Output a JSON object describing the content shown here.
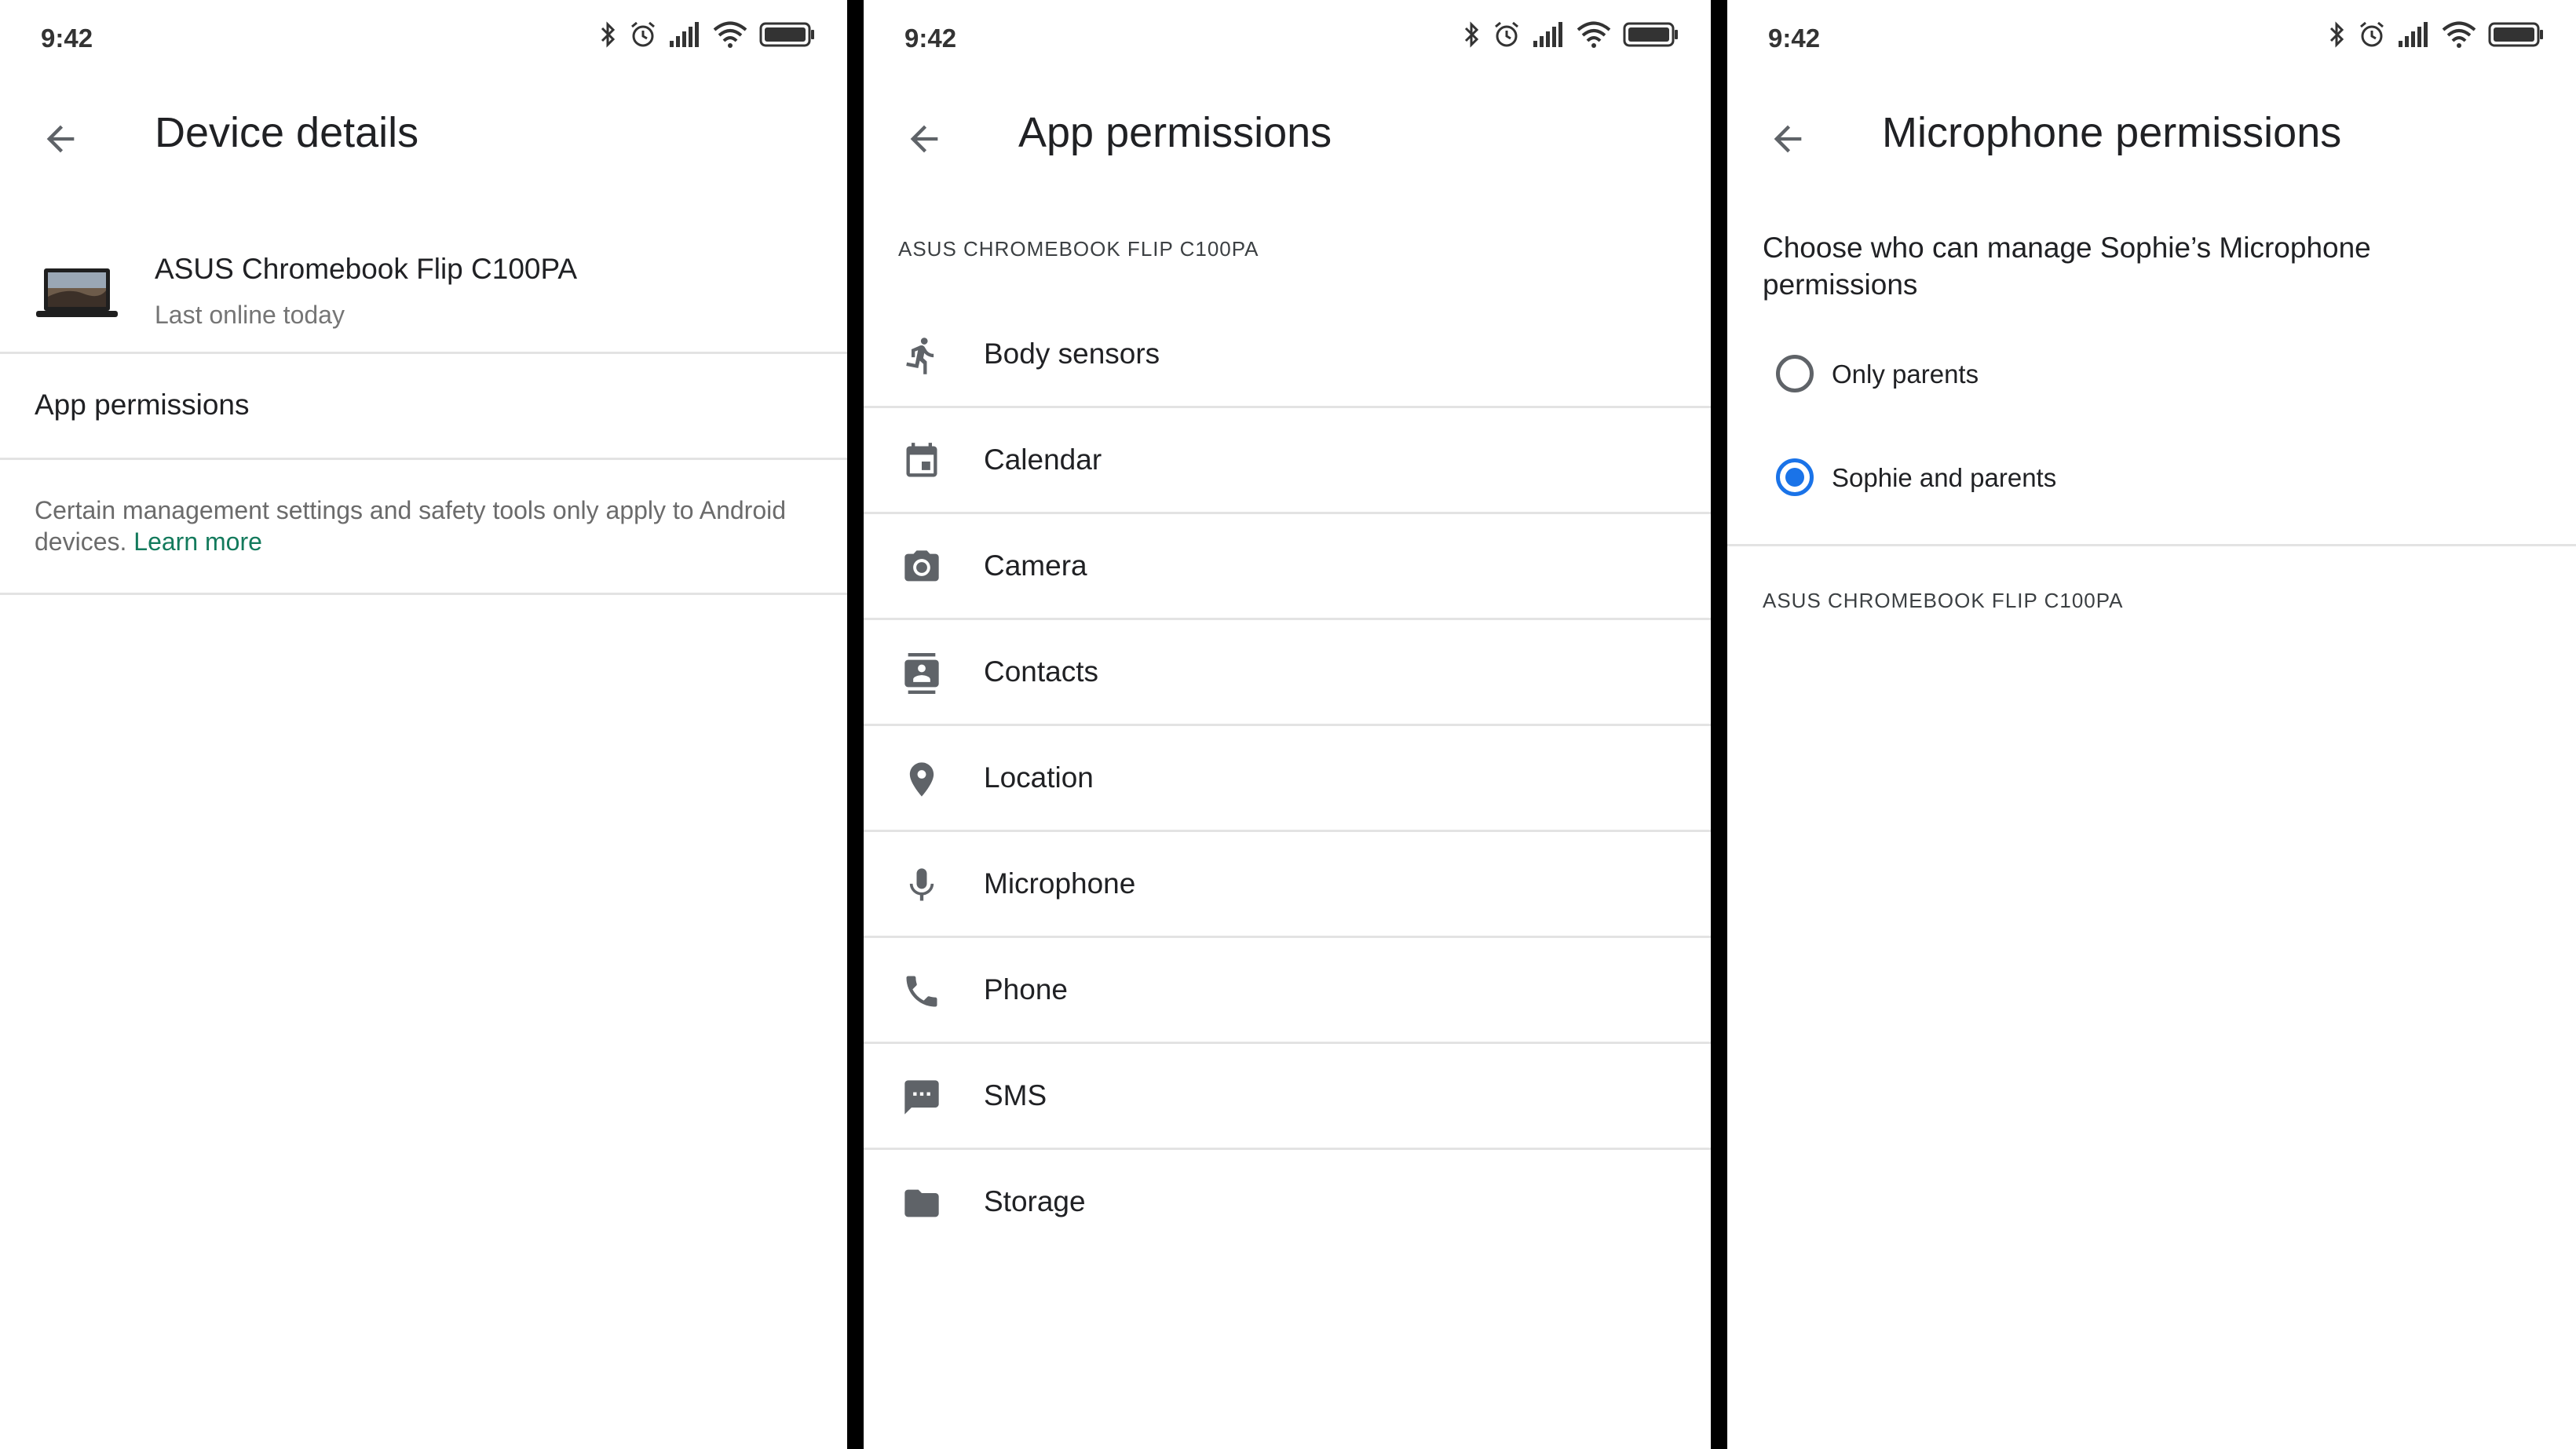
{
  "status_bar": {
    "time": "9:42"
  },
  "screen1": {
    "title": "Device details",
    "device": {
      "name": "ASUS Chromebook Flip C100PA",
      "status": "Last online today"
    },
    "app_permissions_label": "App permissions",
    "note_text": "Certain management settings and safety tools only apply to Android devices.",
    "learn_more_label": "Learn more"
  },
  "screen2": {
    "title": "App permissions",
    "device_label": "ASUS CHROMEBOOK FLIP C100PA",
    "items": [
      {
        "label": "Body sensors",
        "icon": "body-sensors-icon"
      },
      {
        "label": "Calendar",
        "icon": "calendar-icon"
      },
      {
        "label": "Camera",
        "icon": "camera-icon"
      },
      {
        "label": "Contacts",
        "icon": "contacts-icon"
      },
      {
        "label": "Location",
        "icon": "location-icon"
      },
      {
        "label": "Microphone",
        "icon": "microphone-icon"
      },
      {
        "label": "Phone",
        "icon": "phone-icon"
      },
      {
        "label": "SMS",
        "icon": "sms-icon"
      },
      {
        "label": "Storage",
        "icon": "storage-icon"
      }
    ]
  },
  "screen3": {
    "title": "Microphone permissions",
    "prompt": "Choose who can manage Sophie’s Microphone permissions",
    "options": [
      {
        "label": "Only parents",
        "selected": false
      },
      {
        "label": "Sophie and parents",
        "selected": true
      }
    ],
    "device_label": "ASUS CHROMEBOOK FLIP C100PA"
  },
  "colors": {
    "accent": "#1a73e8",
    "link": "#137a5c",
    "icon_gray": "#5f6368",
    "divider": "#e3e3e3"
  }
}
